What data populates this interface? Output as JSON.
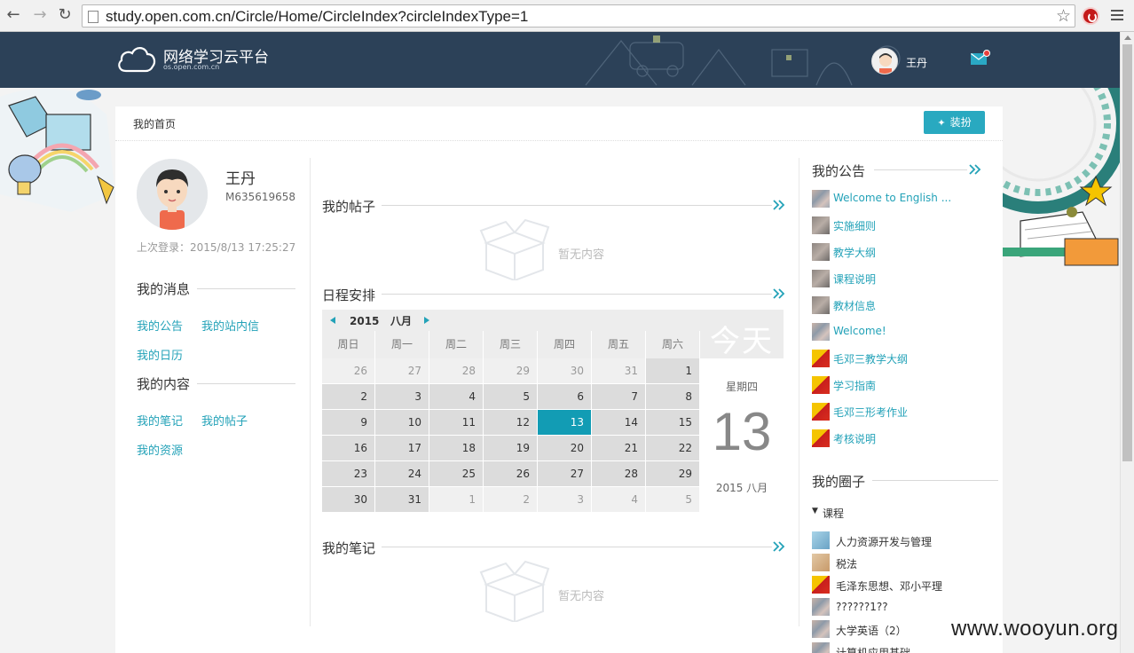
{
  "browser": {
    "url": "study.open.com.cn/Circle/Home/CircleIndex?circleIndexType=1"
  },
  "header": {
    "logo_title": "网络学习云平台",
    "logo_sub": "os.open.com.cn",
    "user_name": "王丹"
  },
  "page": {
    "breadcrumb": "我的首页",
    "dress_button": "装扮"
  },
  "profile": {
    "name": "王丹",
    "id": "M635619658",
    "last_login": "上次登录：2015/8/13 17:25:27"
  },
  "left_nav": {
    "messages_title": "我的消息",
    "messages_links": [
      "我的公告",
      "我的站内信",
      "我的日历"
    ],
    "content_title": "我的内容",
    "content_links": [
      "我的笔记",
      "我的帖子",
      "我的资源"
    ]
  },
  "posts": {
    "title": "我的帖子",
    "empty": "暂无内容"
  },
  "schedule": {
    "title": "日程安排",
    "year": "2015",
    "month": "八月",
    "weekdays": [
      "周日",
      "周一",
      "周二",
      "周三",
      "周四",
      "周五",
      "周六"
    ],
    "weeks": [
      [
        "26",
        "27",
        "28",
        "29",
        "30",
        "31",
        "1"
      ],
      [
        "2",
        "3",
        "4",
        "5",
        "6",
        "7",
        "8"
      ],
      [
        "9",
        "10",
        "11",
        "12",
        "13",
        "14",
        "15"
      ],
      [
        "16",
        "17",
        "18",
        "19",
        "20",
        "21",
        "22"
      ],
      [
        "23",
        "24",
        "25",
        "26",
        "27",
        "28",
        "29"
      ],
      [
        "30",
        "31",
        "1",
        "2",
        "3",
        "4",
        "5"
      ]
    ],
    "today_label": "今天",
    "today_weekday": "星期四",
    "today_day": "13",
    "today_ym": "2015 八月"
  },
  "notes": {
    "title": "我的笔记",
    "empty": "暂无内容"
  },
  "announcements": {
    "title": "我的公告",
    "items": [
      {
        "text": "Welcome to English ...",
        "thumb": "photo"
      },
      {
        "text": "实施细则",
        "thumb": "grey"
      },
      {
        "text": "教学大纲",
        "thumb": "grey"
      },
      {
        "text": "课程说明",
        "thumb": "grey"
      },
      {
        "text": "教材信息",
        "thumb": "grey"
      },
      {
        "text": "Welcome!",
        "thumb": "photo"
      },
      {
        "text": "毛邓三教学大纲",
        "thumb": "red"
      },
      {
        "text": "学习指南",
        "thumb": "red"
      },
      {
        "text": "毛邓三形考作业",
        "thumb": "red"
      },
      {
        "text": "考核说明",
        "thumb": "red"
      }
    ]
  },
  "circles": {
    "title": "我的圈子",
    "group": "课程",
    "items": [
      {
        "text": "人力资源开发与管理",
        "thumb": "blue"
      },
      {
        "text": "税法",
        "thumb": "tan"
      },
      {
        "text": "毛泽东思想、邓小平理",
        "thumb": "red"
      },
      {
        "text": "??????1??",
        "thumb": "photo"
      },
      {
        "text": "大学英语（2）",
        "thumb": "photo"
      },
      {
        "text": "计算机应用基础",
        "thumb": "photo"
      }
    ]
  },
  "watermark": "www.wooyun.org",
  "colors": {
    "accent": "#23a2b8",
    "header_bg": "#2c4158",
    "today": "#129cb4"
  }
}
